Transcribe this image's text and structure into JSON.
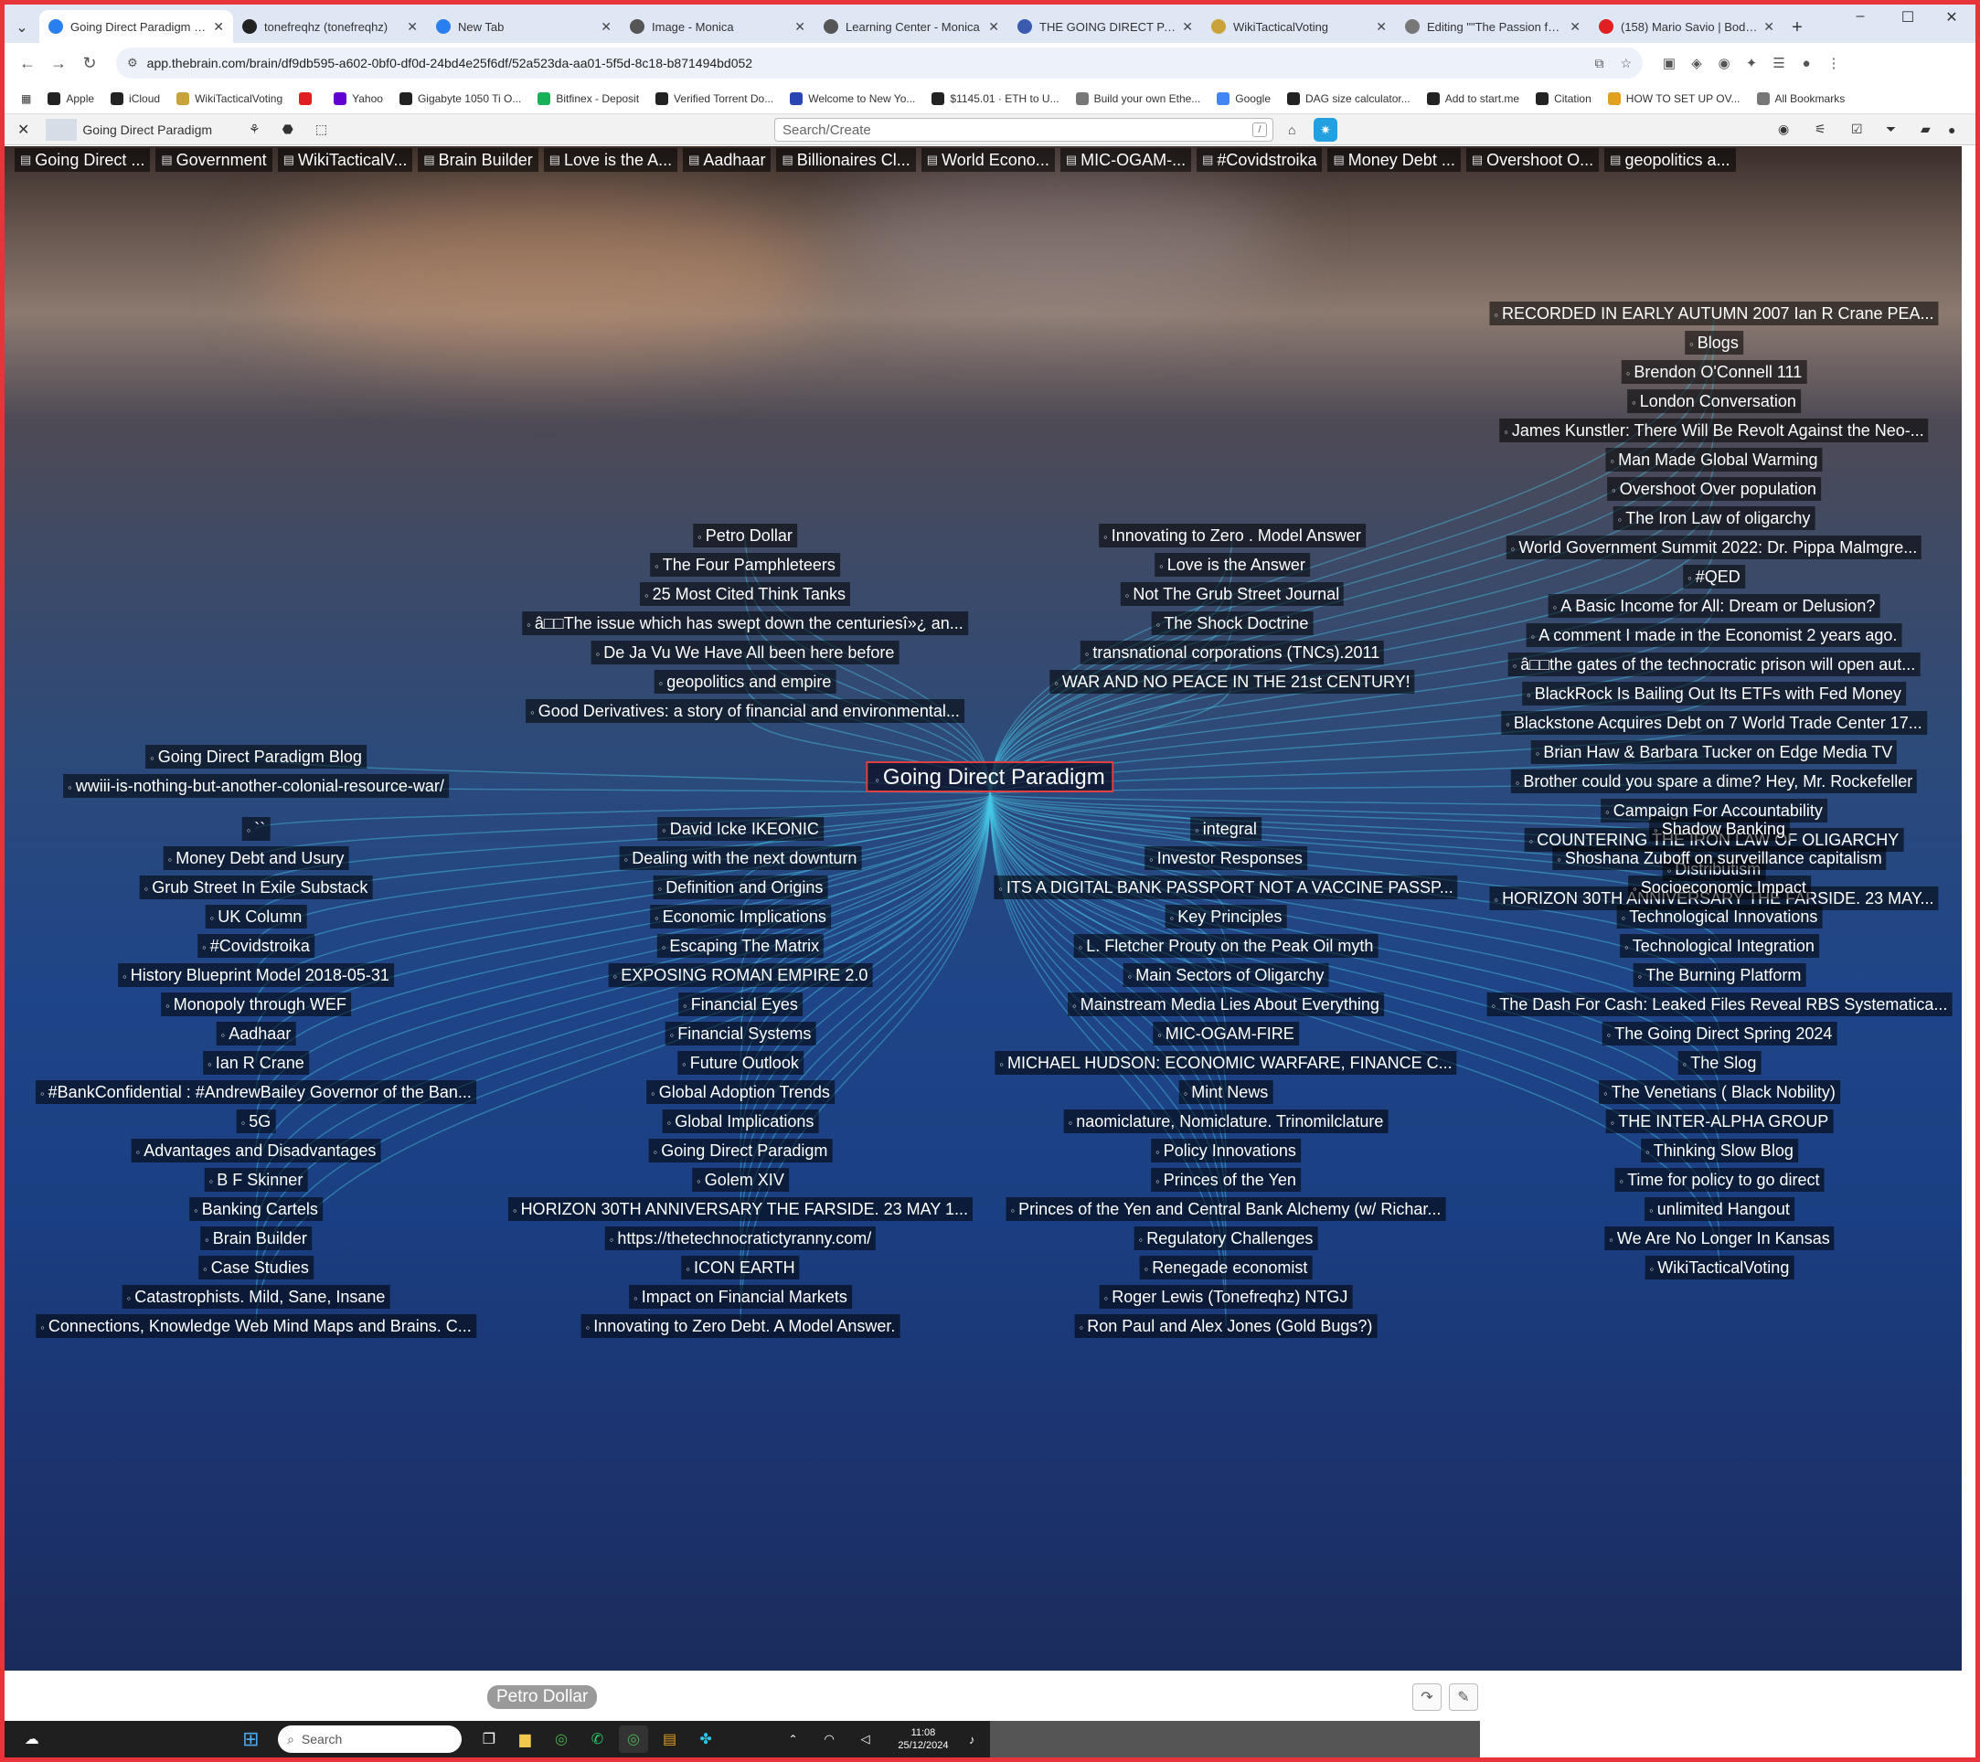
{
  "tabs": [
    {
      "title": "Going Direct Paradigm | G",
      "color": "#2a7ff0",
      "active": true
    },
    {
      "title": "tonefreqhz (tonefreqhz)",
      "color": "#222"
    },
    {
      "title": "New Tab",
      "color": "#2a7ff0"
    },
    {
      "title": "Image - Monica",
      "color": "#555"
    },
    {
      "title": "Learning Center - Monica",
      "color": "#555"
    },
    {
      "title": "THE GOING DIRECT PARA",
      "color": "#3a5bb0"
    },
    {
      "title": "WikiTacticalVoting",
      "color": "#c9a23a"
    },
    {
      "title": "Editing \"\"The Passion for T",
      "color": "#777"
    },
    {
      "title": "(158) Mario Savio | Bodies",
      "color": "#e02020"
    }
  ],
  "address": {
    "url": "app.thebrain.com/brain/df9db595-a602-0bf0-df0d-24bd4e25f6df/52a523da-aa01-5f5d-8c18-b871494bd052"
  },
  "bookmarks": [
    {
      "label": "Apple",
      "color": "#222"
    },
    {
      "label": "iCloud",
      "color": "#222"
    },
    {
      "label": "WikiTacticalVoting",
      "color": "#c9a23a"
    },
    {
      "label": "",
      "color": "#e02020"
    },
    {
      "label": "Yahoo",
      "color": "#6001d2"
    },
    {
      "label": "Gigabyte 1050 Ti O...",
      "color": "#222"
    },
    {
      "label": "Bitfinex - Deposit",
      "color": "#16b157"
    },
    {
      "label": "Verified Torrent Do...",
      "color": "#222"
    },
    {
      "label": "Welcome to New Yo...",
      "color": "#2a44b0"
    },
    {
      "label": "$1145.01 · ETH to U...",
      "color": "#222"
    },
    {
      "label": "Build your own Ethe...",
      "color": "#777"
    },
    {
      "label": "Google",
      "color": "#4285f4"
    },
    {
      "label": "DAG size calculator...",
      "color": "#222"
    },
    {
      "label": "Add to start.me",
      "color": "#222"
    },
    {
      "label": "Citation",
      "color": "#222"
    },
    {
      "label": "HOW TO SET UP OV...",
      "color": "#e0a020"
    },
    {
      "label": "All Bookmarks",
      "color": "#777"
    }
  ],
  "brain": {
    "title": "Going Direct Paradigm",
    "search_placeholder": "Search/Create",
    "slash": "/"
  },
  "pins": [
    "Going Direct ...",
    "Government",
    "WikiTacticalV...",
    "Brain Builder",
    "Love is the A...",
    "Aadhaar",
    "Billionaires Cl...",
    "World Econo...",
    "MIC-OGAM-...",
    "#Covidstroika",
    "Money Debt ...",
    "Overshoot O...",
    "geopolitics a..."
  ],
  "center": "Going Direct Paradigm",
  "parents": [
    "Petro Dollar",
    "The Four Pamphleteers",
    "25 Most Cited Think Tanks",
    "â□□The issue which has swept down the centuriesî»¿ an...",
    "De Ja Vu We Have All been here before",
    "geopolitics and empire",
    "Good Derivatives: a story of financial and environmental..."
  ],
  "parents_right": [
    "Innovating to Zero . Model Answer",
    "Love is the Answer",
    "Not The Grub Street Journal",
    "The Shock Doctrine",
    "transnational corporations (TNCs).2011",
    "WAR AND NO PEACE IN THE 21st CENTURY!"
  ],
  "jumps": [
    "Going Direct Paradigm Blog",
    "wwiii-is-nothing-but-another-colonial-resource-war/"
  ],
  "right_top": [
    "RECORDED IN EARLY AUTUMN 2007 Ian R Crane PEA...",
    "Blogs",
    "Brendon O'Connell 111",
    "London Conversation",
    "James Kunstler: There Will Be Revolt Against the Neo-...",
    "Man Made Global Warming",
    "Overshoot Over population",
    "The Iron Law of oligarchy",
    "World Government Summit 2022: Dr. Pippa Malmgre...",
    "#QED",
    "A Basic Income for All: Dream or Delusion?",
    "A comment I made in the Economist 2 years ago.",
    "â□□the gates of the technocratic prison will open aut...",
    "BlackRock Is Bailing Out Its ETFs with Fed Money",
    "Blackstone Acquires Debt on 7 World Trade Center 17...",
    "Brian Haw & Barbara Tucker on Edge Media TV",
    "Brother could you spare a dime? Hey, Mr. Rockefeller",
    "Campaign For Accountability",
    "COUNTERING THE IRON LAW OF OLIGARCHY",
    "Distributism",
    "HORIZON 30TH ANNIVERSARY THE FARSIDE. 23 MAY..."
  ],
  "col1": [
    "``",
    "Money Debt and Usury",
    "Grub Street In Exile Substack",
    "UK Column",
    "#Covidstroika",
    "History Blueprint Model 2018-05-31",
    "Monopoly through WEF",
    "Aadhaar",
    "Ian R Crane",
    "#BankConfidential : #AndrewBailey Governor of the Ban...",
    "5G",
    "Advantages and Disadvantages",
    "B F Skinner",
    "Banking Cartels",
    "Brain Builder",
    "Case Studies",
    "Catastrophists. Mild, Sane, Insane",
    "Connections, Knowledge Web Mind Maps and Brains. C..."
  ],
  "col2": [
    "David Icke IKEONIC",
    "Dealing with the next downturn",
    "Definition and Origins",
    "Economic Implications",
    "Escaping The Matrix",
    "EXPOSING ROMAN EMPIRE 2.0",
    "Financial Eyes",
    "Financial Systems",
    "Future Outlook",
    "Global Adoption Trends",
    "Global Implications",
    "Going Direct Paradigm",
    "Golem XIV",
    "HORIZON 30TH ANNIVERSARY THE FARSIDE. 23 MAY 1...",
    "https://thetechnocratictyranny.com/",
    "ICON EARTH",
    "Impact on Financial Markets",
    "Innovating to Zero Debt. A Model Answer."
  ],
  "col3": [
    "integral",
    "Investor Responses",
    "ITS A DIGITAL BANK PASSPORT NOT A VACCINE PASSP...",
    "Key Principles",
    "L. Fletcher Prouty on the Peak Oil myth",
    "Main Sectors of Oligarchy",
    "Mainstream Media Lies About Everything",
    "MIC-OGAM-FIRE",
    "MICHAEL HUDSON: ECONOMIC WARFARE, FINANCE C...",
    "Mint News",
    "naomiclature, Nomiclature. Trinomilclature",
    "Policy Innovations",
    "Princes of the Yen",
    "Princes of the Yen and Central Bank Alchemy (w/ Richar...",
    "Regulatory Challenges",
    "Renegade economist",
    "Roger Lewis (Tonefreqhz) NTGJ",
    "Ron Paul and Alex Jones (Gold Bugs?)"
  ],
  "col4": [
    "Shadow Banking",
    "Shoshana Zuboff on surveillance capitalism",
    "Socioeconomic Impact",
    "Technological Innovations",
    "Technological Integration",
    "The Burning Platform",
    "The Dash For Cash: Leaked Files Reveal RBS Systematica...",
    "The Going Direct Spring 2024",
    "The Slog",
    "The Venetians ( Black Nobility)",
    "THE INTER-ALPHA GROUP",
    "Thinking Slow Blog",
    "Time for policy to go direct",
    "unlimited Hangout",
    "We Are No Longer In Kansas",
    "WikiTacticalVoting"
  ],
  "notes": {
    "selected": "Petro Dollar"
  },
  "taskbar": {
    "search": "Search",
    "time": "11:08",
    "date": "25/12/2024"
  }
}
